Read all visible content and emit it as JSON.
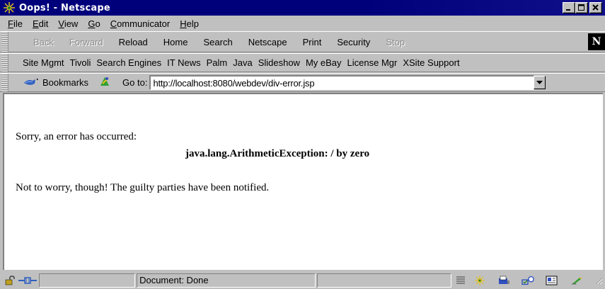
{
  "window": {
    "title": "Oops! - Netscape",
    "buttons": {
      "minimize": "_",
      "maximize": "□",
      "close": "×"
    }
  },
  "menu": {
    "items": [
      {
        "label": "File",
        "accel": "F",
        "rest": "ile"
      },
      {
        "label": "Edit",
        "accel": "E",
        "rest": "dit"
      },
      {
        "label": "View",
        "accel": "V",
        "rest": "iew"
      },
      {
        "label": "Go",
        "accel": "G",
        "rest": "o"
      },
      {
        "label": "Communicator",
        "accel": "C",
        "rest": "ommunicator"
      },
      {
        "label": "Help",
        "accel": "H",
        "rest": "elp"
      }
    ]
  },
  "nav_toolbar": {
    "buttons": [
      {
        "label": "Back",
        "enabled": false
      },
      {
        "label": "Forward",
        "enabled": false
      },
      {
        "label": "Reload",
        "enabled": true
      },
      {
        "label": "Home",
        "enabled": true
      },
      {
        "label": "Search",
        "enabled": true
      },
      {
        "label": "Netscape",
        "enabled": true
      },
      {
        "label": "Print",
        "enabled": true
      },
      {
        "label": "Security",
        "enabled": true
      },
      {
        "label": "Stop",
        "enabled": false
      }
    ],
    "logo": "N"
  },
  "links_toolbar": {
    "items": [
      "Site Mgmt",
      "Tivoli",
      "Search Engines",
      "IT News",
      "Palm",
      "Java",
      "Slideshow",
      "My eBay",
      "License Mgr",
      "XSite Support"
    ]
  },
  "location_toolbar": {
    "bookmarks_label": "Bookmarks",
    "goto_label": "Go to:",
    "url": "http://localhost:8080/webdev/div-error.jsp"
  },
  "content": {
    "line1": "Sorry, an error has occurred:",
    "exception": "java.lang.ArithmeticException: / by zero",
    "line2": "Not to worry, though! The guilty parties have been notified."
  },
  "status_bar": {
    "status_text": "Document: Done"
  },
  "colors": {
    "titlebar": "#00007b",
    "chrome": "#c0c0c0",
    "content_bg": "#ffffff"
  }
}
